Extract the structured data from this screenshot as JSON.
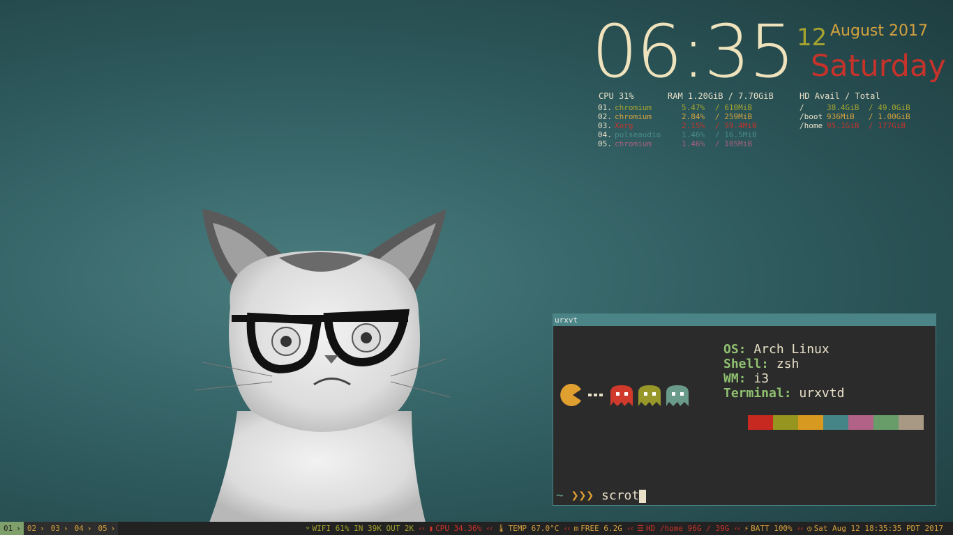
{
  "clock": {
    "time": "06:35",
    "day": "12",
    "month_year": "August 2017",
    "weekday": "Saturday"
  },
  "stats": {
    "cpu": {
      "label": "CPU",
      "value": "31%"
    },
    "ram": {
      "label": "RAM",
      "value": "1.20GiB / 7.70GiB"
    },
    "hd": {
      "label": "HD",
      "value": "Avail / Total"
    },
    "processes": [
      {
        "num": "01.",
        "name": "chromium",
        "cpu": "5.47%",
        "mem": "/ 610MiB",
        "color": "#a6a42f"
      },
      {
        "num": "02.",
        "name": "chromium",
        "cpu": "2.84%",
        "mem": "/ 259MiB",
        "color": "#d4a23e"
      },
      {
        "num": "03.",
        "name": "Xorg",
        "cpu": "2.15%",
        "mem": "/ 59.4MiB",
        "color": "#c7332b"
      },
      {
        "num": "04.",
        "name": "pulseaudio",
        "cpu": "1.46%",
        "mem": "/ 16.5MiB",
        "color": "#4a8a8a"
      },
      {
        "num": "05.",
        "name": "chromium",
        "cpu": "1.46%",
        "mem": "/ 105MiB",
        "color": "#a86080"
      }
    ],
    "disks": [
      {
        "mount": "/",
        "avail": "38.4GiB",
        "total": "/ 49.0GiB",
        "color": "#a6a42f"
      },
      {
        "mount": "/boot",
        "avail": "936MiB",
        "total": "/ 1.00GiB",
        "color": "#d4a23e"
      },
      {
        "mount": "/home",
        "avail": "95.1GiB",
        "total": "/ 177GiB",
        "color": "#c7332b"
      }
    ]
  },
  "terminal": {
    "title": "urxvt",
    "sysinfo": [
      {
        "key": "OS:",
        "value": "Arch Linux"
      },
      {
        "key": "Shell:",
        "value": "zsh"
      },
      {
        "key": "WM:",
        "value": "i3"
      },
      {
        "key": "Terminal:",
        "value": "urxvtd"
      }
    ],
    "palette": [
      "#c7281f",
      "#95951f",
      "#d79920",
      "#458588",
      "#b16286",
      "#689d6a",
      "#a89984"
    ],
    "prompt_tilde": "~",
    "prompt_arrows": "❯❯❯",
    "command": "scrot"
  },
  "bar": {
    "workspaces": [
      {
        "label": "01",
        "active": true
      },
      {
        "label": "02",
        "active": false
      },
      {
        "label": "03",
        "active": false
      },
      {
        "label": "04",
        "active": false
      },
      {
        "label": "05",
        "active": false
      }
    ],
    "status": [
      {
        "icon": "wifi-icon",
        "glyph": "⌔",
        "text": "WIFI 61% IN 39K OUT 2K",
        "color": "#a6a42f"
      },
      {
        "icon": "cpu-icon",
        "glyph": "▮",
        "text": "CPU 34.36%",
        "color": "#c7332b"
      },
      {
        "icon": "thermometer-icon",
        "glyph": "🌡",
        "text": "TEMP 67.0°C",
        "color": "#d4a23e"
      },
      {
        "icon": "memory-icon",
        "glyph": "m",
        "text": "FREE 6.2G",
        "color": "#d4a23e"
      },
      {
        "icon": "disk-icon",
        "glyph": "☰",
        "text": "HD /home 96G / 39G",
        "color": "#c7332b"
      },
      {
        "icon": "battery-plug-icon",
        "glyph": "⚡",
        "text": "BATT 100%",
        "color": "#d4a23e"
      },
      {
        "icon": "clock-icon",
        "glyph": "◷",
        "text": "Sat Aug 12 18:35:35 PDT 2017",
        "color": "#d4a23e"
      }
    ]
  }
}
